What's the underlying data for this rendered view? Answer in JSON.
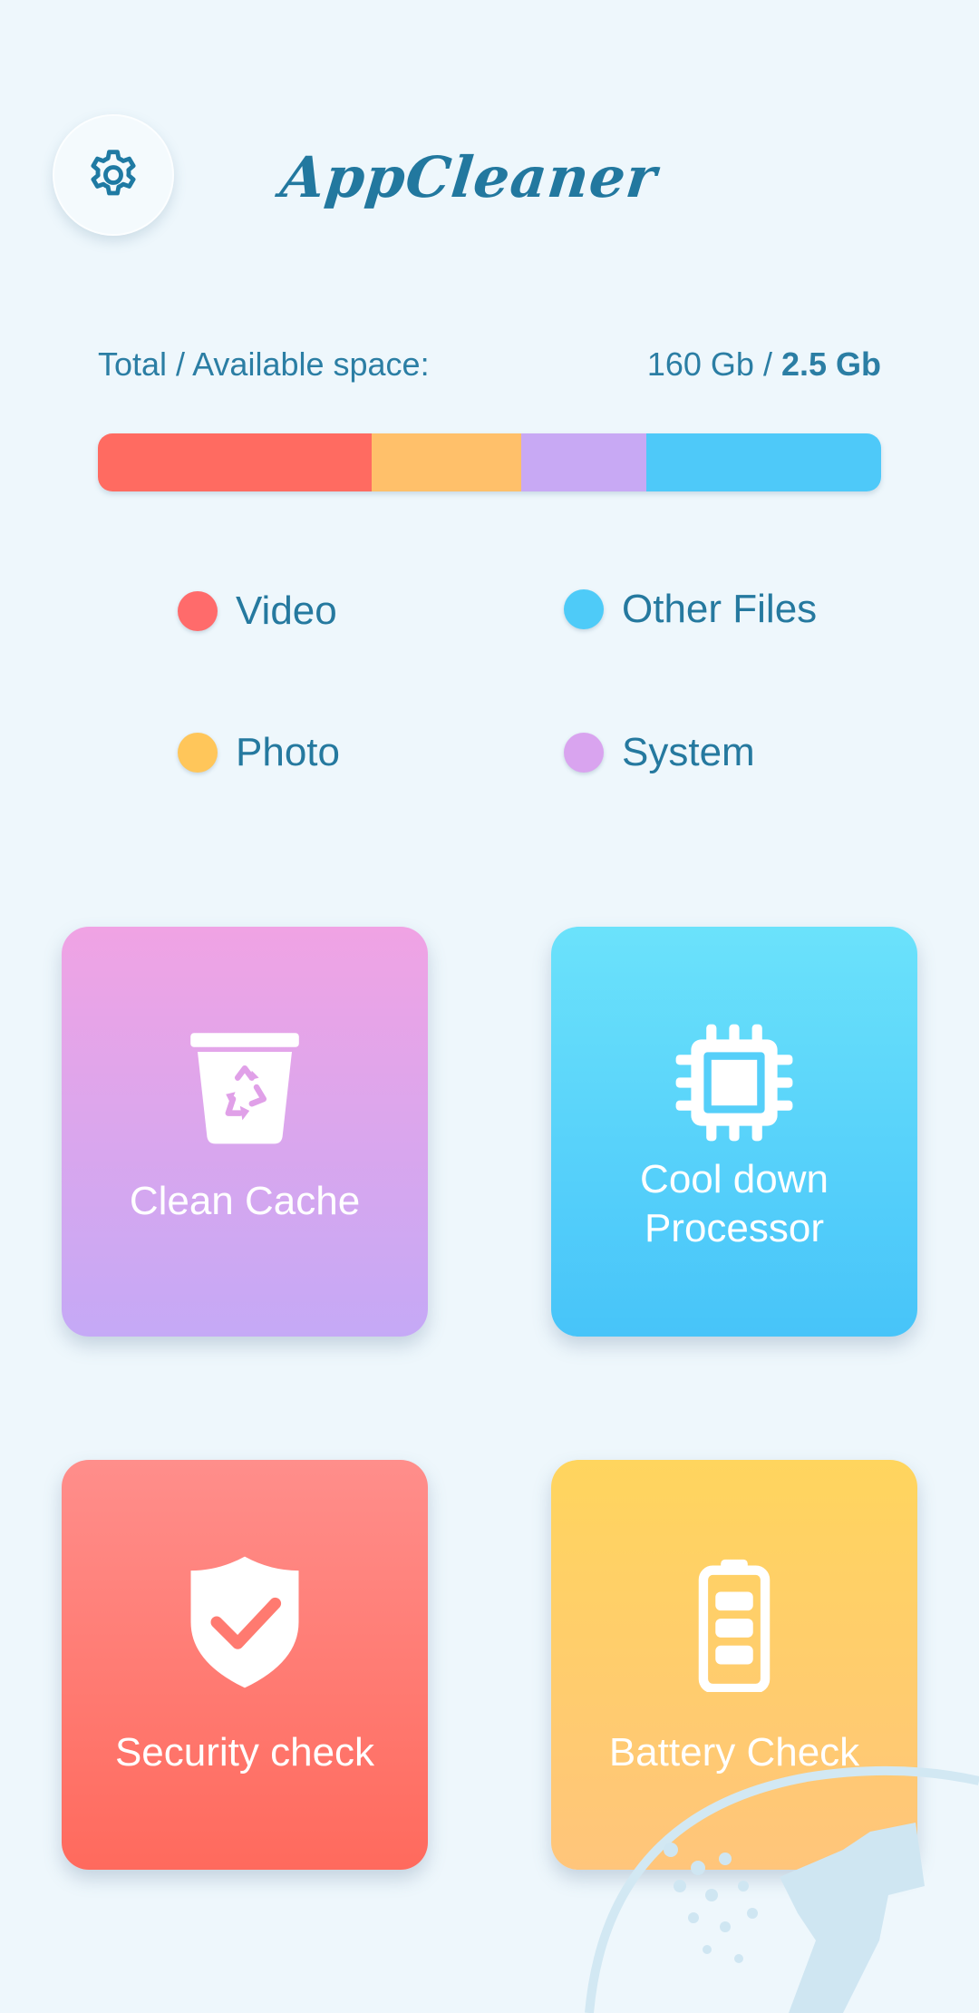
{
  "header": {
    "title": "AppCleaner",
    "settings_icon": "gear-icon"
  },
  "storage": {
    "label": "Total / Available space:",
    "total": "160 Gb",
    "separator": " / ",
    "available": "2.5 Gb",
    "segments": [
      {
        "name": "Video",
        "fraction": 0.35,
        "color": "#ff6b61"
      },
      {
        "name": "Photo",
        "fraction": 0.19,
        "color": "#ffc06a"
      },
      {
        "name": "System",
        "fraction": 0.16,
        "color": "#c8a9f4"
      },
      {
        "name": "Other Files",
        "fraction": 0.3,
        "color": "#4ec9f9"
      }
    ]
  },
  "legend": [
    {
      "label": "Video",
      "color": "#ff6b6b"
    },
    {
      "label": "Other Files",
      "color": "#4ecbf8"
    },
    {
      "label": "Photo",
      "color": "#ffc65a"
    },
    {
      "label": "System",
      "color": "#d9a4ef"
    }
  ],
  "tiles": {
    "cache": {
      "label": "Clean Cache",
      "icon": "trash-recycle-icon"
    },
    "cpu": {
      "label_line1": "Cool down",
      "label_line2": "Processor",
      "icon": "processor-chip-icon"
    },
    "security": {
      "label": "Security check",
      "icon": "shield-check-icon"
    },
    "battery": {
      "label": "Battery Check",
      "icon": "battery-icon"
    }
  }
}
